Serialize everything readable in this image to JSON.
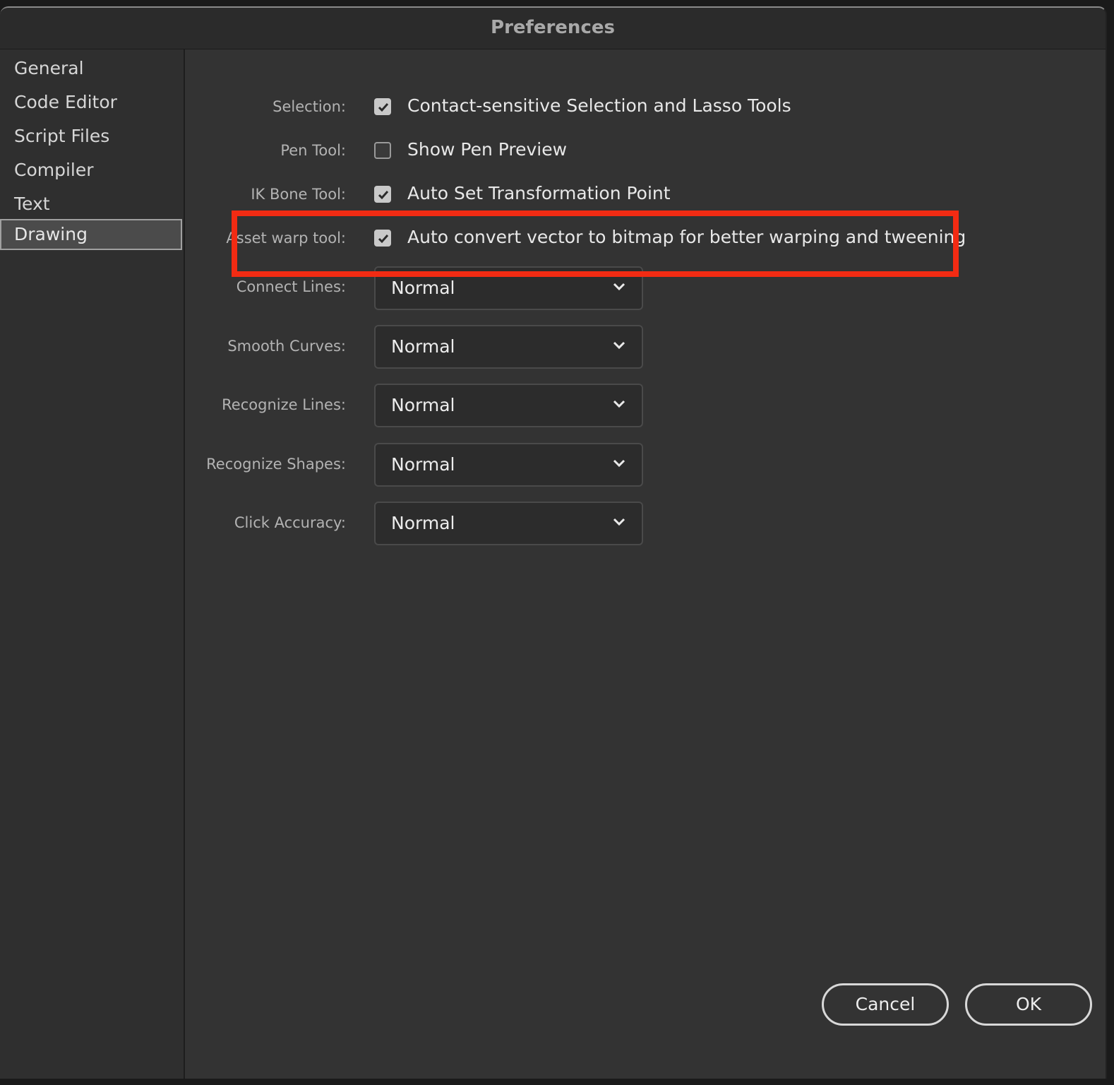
{
  "window": {
    "title": "Preferences"
  },
  "sidebar": {
    "items": [
      {
        "label": "General"
      },
      {
        "label": "Code Editor"
      },
      {
        "label": "Script Files"
      },
      {
        "label": "Compiler"
      },
      {
        "label": "Text"
      },
      {
        "label": "Drawing",
        "selected": true
      }
    ]
  },
  "settings": {
    "checkboxes": [
      {
        "label": "Selection:",
        "text": "Contact-sensitive Selection and Lasso Tools",
        "checked": true
      },
      {
        "label": "Pen Tool:",
        "text": "Show Pen Preview",
        "checked": false
      },
      {
        "label": "IK Bone Tool:",
        "text": "Auto Set Transformation Point",
        "checked": true
      },
      {
        "label": "Asset warp tool:",
        "text": "Auto convert vector to bitmap for better warping and tweening",
        "checked": true
      }
    ],
    "dropdowns": [
      {
        "label": "Connect Lines:",
        "value": "Normal"
      },
      {
        "label": "Smooth Curves:",
        "value": "Normal"
      },
      {
        "label": "Recognize Lines:",
        "value": "Normal"
      },
      {
        "label": "Recognize Shapes:",
        "value": "Normal"
      },
      {
        "label": "Click Accuracy:",
        "value": "Normal"
      }
    ]
  },
  "buttons": {
    "cancel": "Cancel",
    "ok": "OK"
  },
  "colors": {
    "highlight": "#f22b13",
    "background": "#333333"
  }
}
